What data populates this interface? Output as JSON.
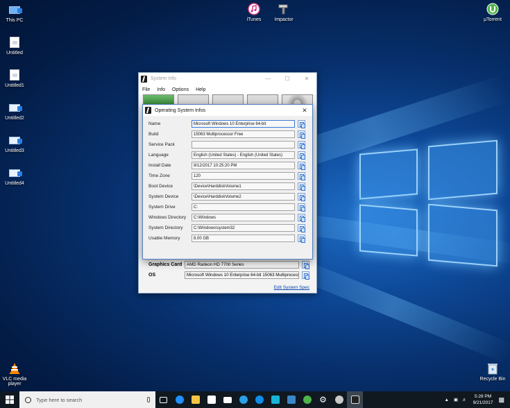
{
  "desktop": {
    "icons_left": [
      {
        "label": "This PC",
        "kind": "monitor"
      },
      {
        "label": "Untitled",
        "kind": "file"
      },
      {
        "label": "Untitled1",
        "kind": "file"
      },
      {
        "label": "Untitled2",
        "kind": "screen"
      },
      {
        "label": "Untitled3",
        "kind": "screen"
      },
      {
        "label": "Untitled4",
        "kind": "screen"
      }
    ],
    "icons_top": [
      {
        "label": "iTunes"
      },
      {
        "label": "Impactor"
      },
      {
        "label": "µTorrent"
      }
    ],
    "vlc_label": "VLC media player",
    "recycle_label": "Recycle Bin"
  },
  "main_window": {
    "title": "System Info",
    "menu": [
      "File",
      "Info",
      "Options",
      "Help"
    ],
    "rows": [
      {
        "label": "Graphics Card",
        "value": "AMD Radeon HD 7700 Series"
      },
      {
        "label": "OS",
        "value": "Microsoft Windows 10 Enterprise 64-bit 15063 Multiprocess"
      }
    ],
    "link": "Edit System Spec"
  },
  "dialog": {
    "title": "Operating System Infos",
    "rows": [
      {
        "label": "Name",
        "value": "Microsoft Windows 10 Enterprise 64-bit"
      },
      {
        "label": "Build",
        "value": "15063 Multiprocessor Free"
      },
      {
        "label": "Service Pack",
        "value": ""
      },
      {
        "label": "Language",
        "value": "English (United States) - English (United States)"
      },
      {
        "label": "Install Date",
        "value": "9/12/2017 10:25:20 PM"
      },
      {
        "label": "Time Zone",
        "value": "120"
      },
      {
        "label": "Boot Device",
        "value": "\\Device\\HarddiskVolume1"
      },
      {
        "label": "System Device",
        "value": "\\Device\\HarddiskVolume2"
      },
      {
        "label": "System Drive",
        "value": "C:"
      },
      {
        "label": "Windows Directory",
        "value": "C:\\Windows"
      },
      {
        "label": "System Directory",
        "value": "C:\\Windows\\system32"
      },
      {
        "label": "Usable Memory",
        "value": "8.00 GB"
      }
    ]
  },
  "taskbar": {
    "search_placeholder": "Type here to search",
    "time": "5:28 PM",
    "date": "9/21/2017",
    "icons": [
      "task-view-icon",
      "edge-icon",
      "file-explorer-icon",
      "store-icon",
      "mail-icon",
      "ie-icon",
      "teamviewer-icon",
      "picpick-icon",
      "remote-desktop-icon",
      "utorrent-icon",
      "settings-icon",
      "paint-icon",
      "system-info-icon"
    ],
    "colors": {
      "accent": "#1e90ff"
    }
  }
}
